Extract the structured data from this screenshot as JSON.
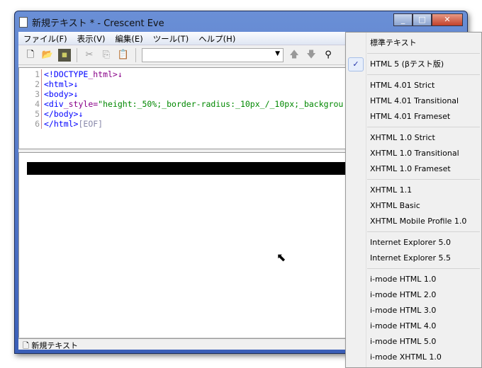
{
  "window": {
    "title": "新規テキスト * - Crescent Eve",
    "controls": [
      "_",
      "□",
      "✕"
    ]
  },
  "menubar": [
    "ファイル(F)",
    "表示(V)",
    "編集(E)",
    "ツール(T)",
    "ヘルプ(H)"
  ],
  "editor": {
    "line_numbers": [
      "1",
      "2",
      "3",
      "4",
      "5",
      "6"
    ],
    "lines": [
      [
        "<!DOCTYPE",
        "_html>↓",
        ""
      ],
      [
        "<html>↓",
        "",
        ""
      ],
      [
        "<body>↓",
        "",
        ""
      ],
      [
        "<div",
        "_style=",
        "\"height:_50%;_border-radius:_10px_/_10px;_backgrou"
      ],
      [
        "</body>↓",
        "",
        ""
      ],
      [
        "</html>",
        "",
        "[EOF]"
      ]
    ]
  },
  "status": {
    "tab": "新規テキスト"
  },
  "popup": {
    "groups": [
      [
        {
          "label": "標準テキスト"
        }
      ],
      [
        {
          "label": "HTML 5 (βテスト版)",
          "checked": true
        }
      ],
      [
        {
          "label": "HTML 4.01 Strict"
        },
        {
          "label": "HTML 4.01 Transitional"
        },
        {
          "label": "HTML 4.01 Frameset"
        }
      ],
      [
        {
          "label": "XHTML 1.0 Strict"
        },
        {
          "label": "XHTML 1.0 Transitional"
        },
        {
          "label": "XHTML 1.0 Frameset"
        }
      ],
      [
        {
          "label": "XHTML 1.1"
        },
        {
          "label": "XHTML Basic"
        },
        {
          "label": "XHTML Mobile Profile 1.0"
        }
      ],
      [
        {
          "label": "Internet Explorer 5.0"
        },
        {
          "label": "Internet Explorer 5.5"
        }
      ],
      [
        {
          "label": "i-mode HTML 1.0"
        },
        {
          "label": "i-mode HTML 2.0"
        },
        {
          "label": "i-mode HTML 3.0"
        },
        {
          "label": "i-mode HTML 4.0"
        },
        {
          "label": "i-mode HTML 5.0"
        },
        {
          "label": "i-mode XHTML 1.0"
        }
      ]
    ],
    "check": "✓"
  }
}
